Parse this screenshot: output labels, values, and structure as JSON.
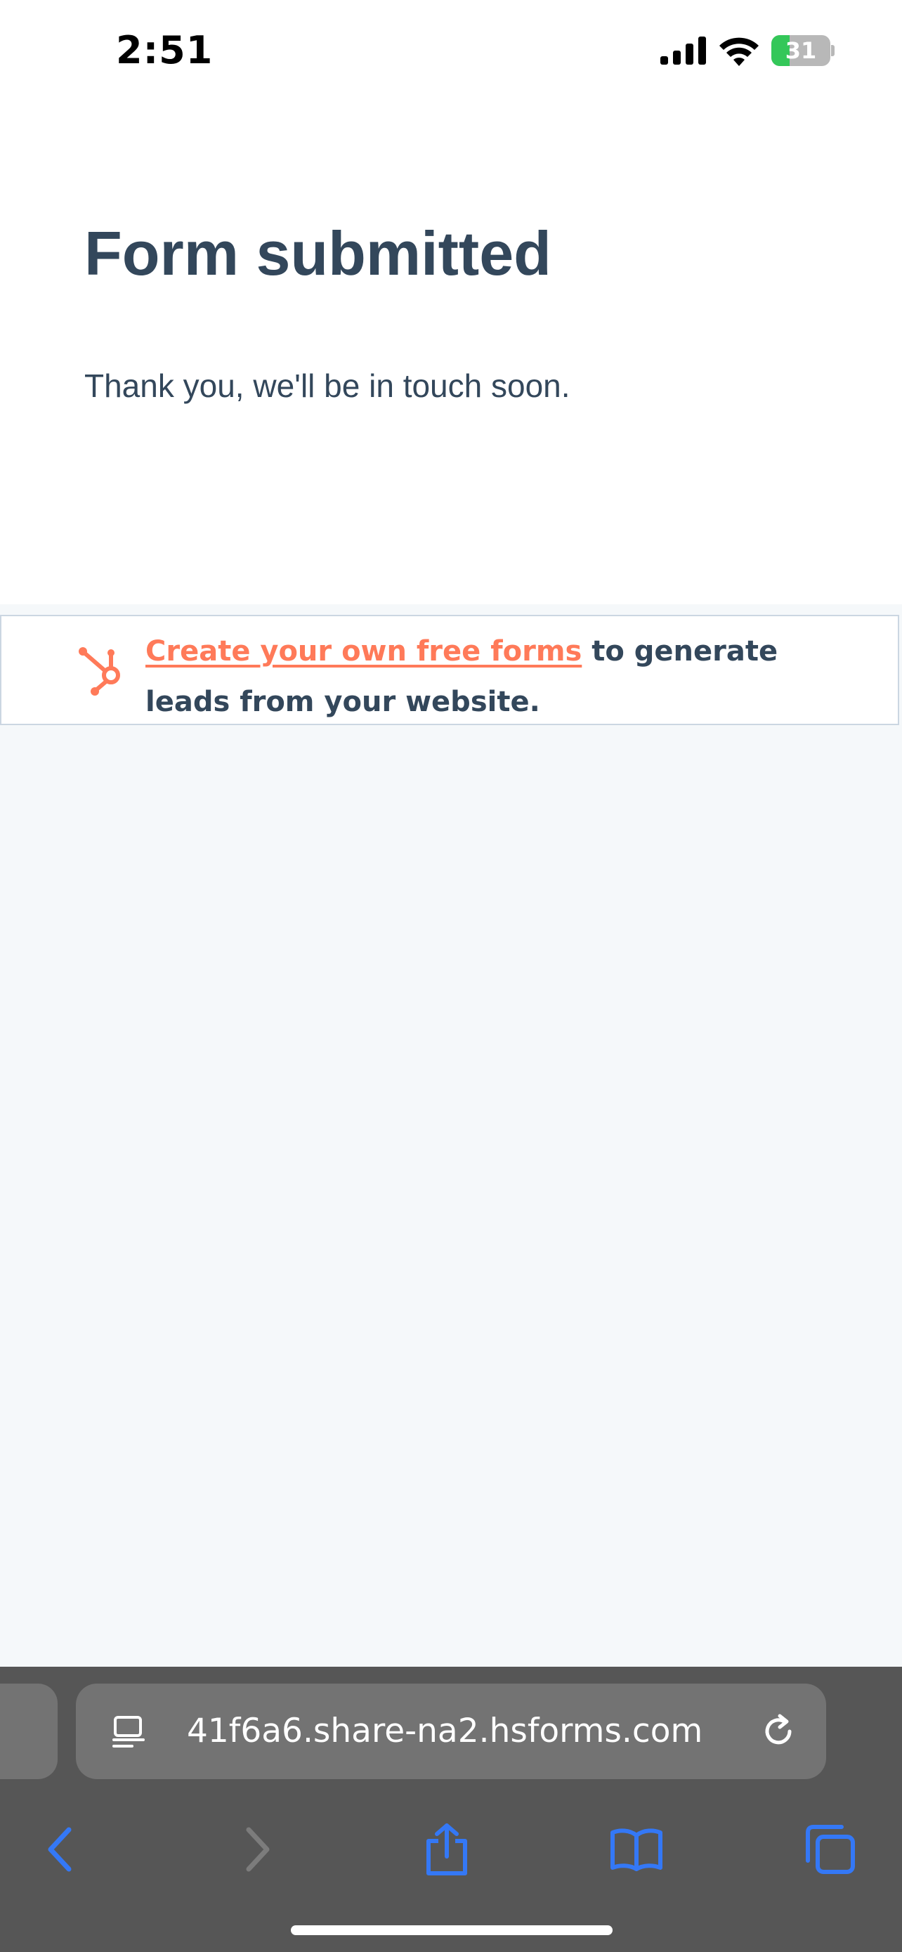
{
  "status_bar": {
    "time": "2:51",
    "battery_text": "31",
    "battery_level": 0.31,
    "battery_color": "#34c759",
    "icons": [
      "signal-icon",
      "wifi-icon",
      "battery-charging-icon"
    ]
  },
  "confirmation": {
    "title": "Form submitted",
    "message": "Thank you, we'll be in touch soon."
  },
  "promo": {
    "icon": "hubspot-sprocket-icon",
    "link_text": "Create your own free forms",
    "rest_text": " to generate leads from your website.",
    "link_color": "#ff7a59"
  },
  "browser": {
    "url": "41f6a6.share-na2.hsforms.com",
    "icons": [
      "page-menu-icon",
      "reload-icon",
      "back-icon",
      "forward-icon",
      "share-icon",
      "bookmarks-icon",
      "tabs-icon"
    ],
    "accent_color": "#3478f6"
  },
  "colors": {
    "heading": "#33475b",
    "page_background": "#f5f8fa",
    "toolbar_background": "#565656"
  }
}
